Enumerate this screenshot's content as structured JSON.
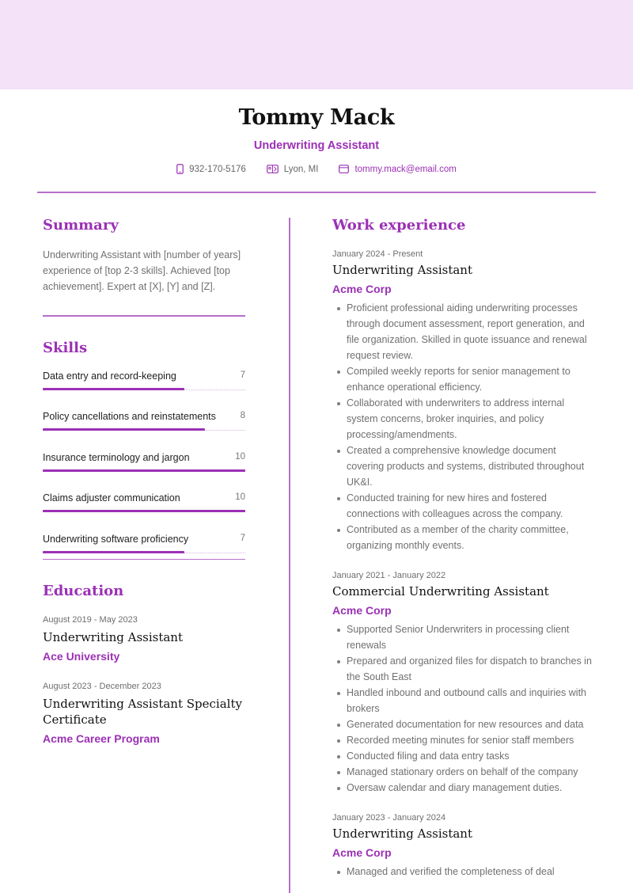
{
  "header": {
    "name": "Tommy Mack",
    "role": "Underwriting Assistant",
    "contacts": {
      "phone": {
        "icon": "phone-icon",
        "value": "932-170-5176"
      },
      "location": {
        "icon": "map-icon",
        "value": "Lyon, MI"
      },
      "email": {
        "icon": "email-icon",
        "value": "tommy.mack@email.com"
      }
    }
  },
  "colors": {
    "accent": "#9b30b5",
    "band": "#f3e2f8",
    "divider": "#b66fc9",
    "body_text": "#707070"
  },
  "summary": {
    "title": "Summary",
    "text": "Underwriting Assistant with [number of years] experience of [top 2-3 skills]. Achieved [top achievement]. Expert at [X], [Y] and [Z]."
  },
  "skills": {
    "title": "Skills",
    "max": 10,
    "items": [
      {
        "label": "Data entry and record-keeping",
        "score": 7
      },
      {
        "label": "Policy cancellations and reinstatements",
        "score": 8
      },
      {
        "label": "Insurance terminology and jargon",
        "score": 10
      },
      {
        "label": "Claims adjuster communication",
        "score": 10
      },
      {
        "label": "Underwriting software proficiency",
        "score": 7
      }
    ]
  },
  "education": {
    "title": "Education",
    "items": [
      {
        "dates": "August 2019 - May 2023",
        "degree": "Underwriting Assistant",
        "school": "Ace University"
      },
      {
        "dates": "August 2023 - December 2023",
        "degree": "Underwriting Assistant Specialty Certificate",
        "school": "Acme Career Program"
      }
    ]
  },
  "experience": {
    "title": "Work experience",
    "items": [
      {
        "dates": "January 2024 - Present",
        "title": "Underwriting Assistant",
        "company": "Acme Corp",
        "bullets": [
          "Proficient professional aiding underwriting processes through document assessment, report generation, and file organization. Skilled in quote issuance and renewal request review.",
          "Compiled weekly reports for senior management to enhance operational efficiency.",
          "Collaborated with underwriters to address internal system concerns, broker inquiries, and policy processing/amendments.",
          "Created a comprehensive knowledge document covering products and systems, distributed throughout UK&I.",
          "Conducted training for new hires and fostered connections with colleagues across the company.",
          "Contributed as a member of the charity committee, organizing monthly events."
        ]
      },
      {
        "dates": "January 2021 - January 2022",
        "title": "Commercial Underwriting Assistant",
        "company": "Acme Corp",
        "bullets": [
          "Supported Senior Underwriters in processing client renewals",
          "Prepared and organized files for dispatch to branches in the South East",
          "Handled inbound and outbound calls and inquiries with brokers",
          "Generated documentation for new resources and data",
          "Recorded meeting minutes for senior staff members",
          "Conducted filing and data entry tasks",
          "Managed stationary orders on behalf of the company",
          "Oversaw calendar and diary management duties."
        ]
      },
      {
        "dates": "January 2023 - January 2024",
        "title": "Underwriting Assistant",
        "company": "Acme Corp",
        "bullets": [
          "Managed and verified the completeness of deal"
        ]
      }
    ]
  }
}
